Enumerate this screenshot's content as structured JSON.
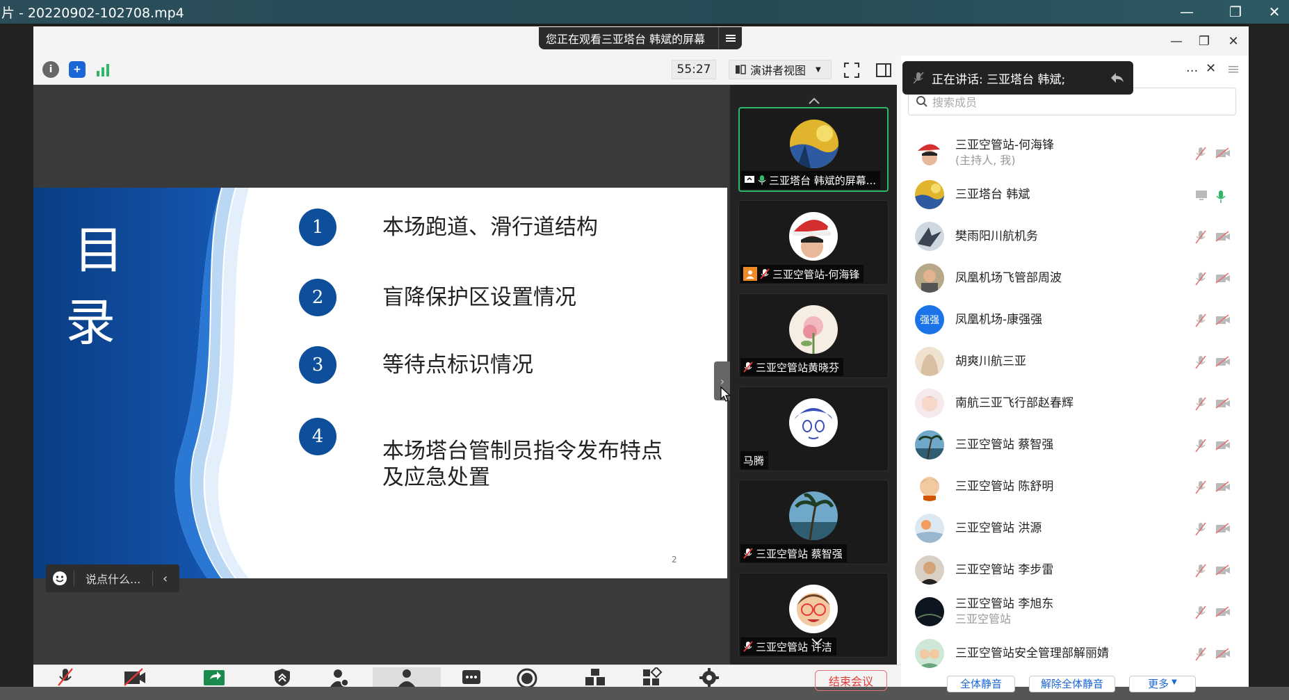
{
  "player": {
    "title": "片 - 20220902-102708.mp4"
  },
  "meeting": {
    "viewing_label": "您正在观看三亚塔台 韩斌的屏幕",
    "timer": "55:27",
    "presenter_view": "演讲者视图"
  },
  "slide": {
    "title_line1": "目",
    "title_line2": "录",
    "items": [
      {
        "num": "1",
        "text": "本场跑道、滑行道结构"
      },
      {
        "num": "2",
        "text": "盲降保护区设置情况"
      },
      {
        "num": "3",
        "text": "等待点标识情况"
      },
      {
        "num": "4",
        "text_line1": "本场塔台管制员指令发布特点",
        "text_line2": "及应急处置"
      }
    ],
    "page_number": "2"
  },
  "comment": {
    "placeholder": "说点什么..."
  },
  "video_tiles": [
    {
      "name": "三亚塔台 韩斌的屏幕..."
    },
    {
      "name": "三亚空管站-何海锋"
    },
    {
      "name": "三亚空管站黄晓芬"
    },
    {
      "name": "马腾"
    },
    {
      "name": "三亚空管站 蔡智强"
    },
    {
      "name": "三亚空管站 许洁"
    }
  ],
  "panel": {
    "speaking": "正在讲话: 三亚塔台 韩斌;",
    "search_placeholder": "搜索成员",
    "members": [
      {
        "name": "三亚空管站-何海锋",
        "sub": "(主持人, 我)"
      },
      {
        "name": "三亚塔台 韩斌",
        "sub": ""
      },
      {
        "name": "樊雨阳川航机务",
        "sub": ""
      },
      {
        "name": "凤凰机场飞管部周波",
        "sub": ""
      },
      {
        "name": "凤凰机场-康强强",
        "sub": "",
        "avatar_text": "强强"
      },
      {
        "name": "胡爽川航三亚",
        "sub": ""
      },
      {
        "name": "南航三亚飞行部赵春辉",
        "sub": ""
      },
      {
        "name": "三亚空管站 蔡智强",
        "sub": ""
      },
      {
        "name": "三亚空管站 陈舒明",
        "sub": ""
      },
      {
        "name": "三亚空管站 洪源",
        "sub": ""
      },
      {
        "name": "三亚空管站 李步雷",
        "sub": ""
      },
      {
        "name": "三亚空管站 李旭东",
        "sub": "三亚空管站"
      },
      {
        "name": "三亚空管站安全管理部解丽婧",
        "sub": ""
      }
    ],
    "buttons": {
      "mute_all": "全体静音",
      "unmute_all": "解除全体静音",
      "more": "更多"
    }
  },
  "bottom": {
    "end_meeting": "结束会议"
  },
  "colors": {
    "slide_blue": "#0e4f9c",
    "active_green": "#2fb86a",
    "end_red": "#e53935",
    "link_blue": "#1a66d6"
  }
}
